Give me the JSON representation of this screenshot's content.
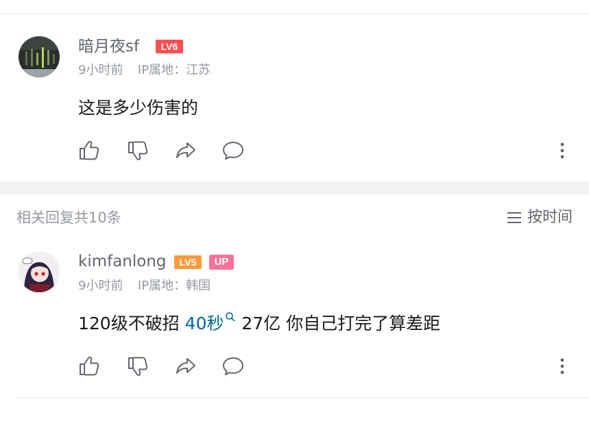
{
  "main_comment": {
    "username": "暗月夜sf",
    "level": "LV6",
    "time": "9小时前",
    "ip_location": "IP属地：江苏",
    "content": "这是多少伤害的"
  },
  "replies_header": {
    "title": "相关回复共10条",
    "sort_label": "按时间"
  },
  "reply": {
    "username": "kimfanlong",
    "level": "LV5",
    "up_badge": "UP",
    "time": "9小时前",
    "ip_location": "IP属地：韩国",
    "content_before": "120级不破招 ",
    "content_link": "40秒",
    "content_after": " 27亿 你自己打完了算差距"
  },
  "colors": {
    "level6": "#fe4e4e",
    "level5": "#ff9a3c",
    "up_badge": "#fb7299",
    "link": "#00699d",
    "meta_text": "#9499a0",
    "section_gap": "#f1f2f3"
  },
  "icons": [
    "like-icon",
    "dislike-icon",
    "share-icon",
    "comment-icon",
    "more-icon",
    "search-icon",
    "sort-lines-icon"
  ]
}
